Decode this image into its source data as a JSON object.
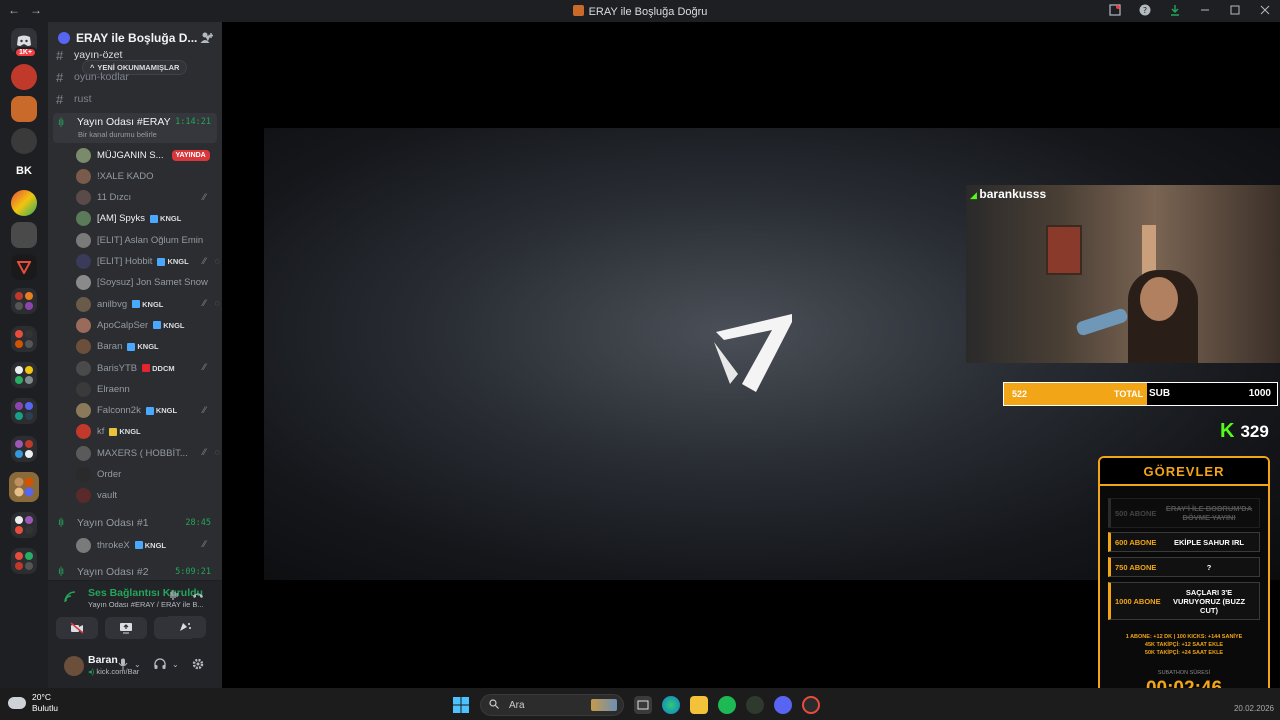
{
  "window": {
    "title": "ERAY ile Boşluğa Doğru",
    "nav_back": "←",
    "nav_forward": "→"
  },
  "servers": {
    "home_badge": "1K+",
    "items": [
      {
        "label": "",
        "color": "#2b2d31"
      },
      {
        "label": "",
        "color": "#c0392b"
      },
      {
        "label": "",
        "color": "#c96a2b"
      },
      {
        "label": "",
        "color": "#3a3a3a"
      },
      {
        "label": "BK",
        "color": "#1e1f22"
      },
      {
        "label": "",
        "color": "#e67e22"
      },
      {
        "label": "",
        "color": "#4a4a4a"
      },
      {
        "label": "",
        "color": "#222"
      },
      {
        "label": "",
        "color": "#333"
      },
      {
        "label": "",
        "color": "#333"
      },
      {
        "label": "",
        "color": "#333"
      },
      {
        "label": "",
        "color": "#333"
      },
      {
        "label": "",
        "color": "#333"
      },
      {
        "label": "",
        "color": "#8a6a3a"
      },
      {
        "label": "",
        "color": "#333"
      },
      {
        "label": "",
        "color": "#333"
      }
    ]
  },
  "guild": {
    "name": "ERAY ile Boşluğa D...",
    "unread_pill": "YENİ OKUNMAMIŞLAR"
  },
  "text_channels": [
    {
      "name": "yayın-özet"
    },
    {
      "name": "oyun-kodlar"
    },
    {
      "name": "rust"
    }
  ],
  "voice_channels": [
    {
      "name": "Yayın Odası #ERAY",
      "timer": "1:14:21",
      "status": "Bir kanal durumu belirle",
      "members": [
        {
          "name": "MÜJGANIN S...",
          "live": "YAYINDA",
          "tag": "",
          "mute": false,
          "deaf": false,
          "bright": true,
          "avatar": "#7a8a6a"
        },
        {
          "name": "!XALE KADO",
          "live": "",
          "tag": "",
          "mute": false,
          "deaf": false,
          "bright": false,
          "avatar": "#7a5a4a"
        },
        {
          "name": "11 Dızcı",
          "live": "",
          "tag": "",
          "mute": true,
          "deaf": false,
          "bright": false,
          "avatar": "#5a4a4a"
        },
        {
          "name": "[AM] Spyks",
          "live": "",
          "tag": "KNGL",
          "tagColor": "b",
          "mute": false,
          "deaf": false,
          "bright": true,
          "avatar": "#5a7a5a"
        },
        {
          "name": "[ELIT] Aslan Oğlum Emin",
          "live": "",
          "tag": "",
          "mute": false,
          "deaf": false,
          "bright": false,
          "avatar": "#7a7a7a"
        },
        {
          "name": "[ELIT] Hobbit",
          "live": "",
          "tag": "KNGL",
          "tagColor": "b",
          "mute": true,
          "deaf": true,
          "bright": false,
          "avatar": "#3a3a5a"
        },
        {
          "name": "[Soysuz] Jon Samet Snow",
          "live": "",
          "tag": "",
          "mute": false,
          "deaf": false,
          "bright": false,
          "avatar": "#8a8a8a"
        },
        {
          "name": "anilbvg",
          "live": "",
          "tag": "KNGL",
          "tagColor": "b",
          "mute": true,
          "deaf": true,
          "bright": false,
          "avatar": "#6a5a4a"
        },
        {
          "name": "ApoCalpSer",
          "live": "",
          "tag": "KNGL",
          "tagColor": "b",
          "mute": false,
          "deaf": false,
          "bright": false,
          "avatar": "#9a6a5a"
        },
        {
          "name": "Baran",
          "live": "",
          "tag": "KNGL",
          "tagColor": "b",
          "mute": false,
          "deaf": false,
          "bright": false,
          "avatar": "#6b4f3a"
        },
        {
          "name": "BarisYTB",
          "live": "",
          "tag": "DDCM",
          "tagColor": "r",
          "mute": true,
          "deaf": false,
          "bright": false,
          "avatar": "#4a4a4a"
        },
        {
          "name": "Elraenn",
          "live": "",
          "tag": "",
          "mute": false,
          "deaf": false,
          "bright": false,
          "avatar": "#3a3a3a"
        },
        {
          "name": "Falconn2k",
          "live": "",
          "tag": "KNGL",
          "tagColor": "b",
          "mute": true,
          "deaf": false,
          "bright": false,
          "avatar": "#8a7a5a"
        },
        {
          "name": "kf",
          "live": "",
          "tag": "KNGL",
          "tagColor": "y",
          "mute": false,
          "deaf": false,
          "bright": false,
          "avatar": "#c0392b"
        },
        {
          "name": "MAXERS ( HOBBİT...",
          "live": "",
          "tag": "",
          "mute": true,
          "deaf": true,
          "bright": false,
          "avatar": "#5a5a5a"
        },
        {
          "name": "Order",
          "live": "",
          "tag": "",
          "mute": false,
          "deaf": false,
          "bright": false,
          "avatar": "#2a2a2a"
        },
        {
          "name": "vault",
          "live": "",
          "tag": "",
          "mute": false,
          "deaf": false,
          "bright": false,
          "avatar": "#5a2a2a"
        }
      ]
    },
    {
      "name": "Yayın Odası #1",
      "timer": "28:45",
      "members": [
        {
          "name": "throkeX",
          "live": "",
          "tag": "KNGL",
          "tagColor": "b",
          "mute": true,
          "deaf": false,
          "bright": false,
          "avatar": "#7a7a7a"
        }
      ]
    },
    {
      "name": "Yayın Odası #2",
      "timer": "5:09:21",
      "members": []
    }
  ],
  "voice_panel": {
    "status": "Ses Bağlantısı Kuruldu",
    "sub": "Yayın Odası #ERAY / ERAY ile B..."
  },
  "user_panel": {
    "name": "Baran",
    "status": "kick.com/Bar"
  },
  "stream": {
    "cam_title": "barankusss",
    "sub_current": "522",
    "sub_label_a": "TOTAL",
    "sub_label_b": "SUB",
    "sub_goal": "1000",
    "sub_progress": 0.522,
    "kick_count": "329"
  },
  "tasks": {
    "title": "GÖREVLER",
    "rows": [
      {
        "need": "500 ABONE",
        "task": "ERAY'İ İLE BODRUM'DA DÖVME YAYINI",
        "done": true
      },
      {
        "need": "600 ABONE",
        "task": "EKİPLE SAHUR IRL",
        "done": false
      },
      {
        "need": "750 ABONE",
        "task": "?",
        "done": false
      },
      {
        "need": "1000 ABONE",
        "task": "SAÇLARI 3'E VURUYORUZ (BUZZ CUT)",
        "done": false
      }
    ],
    "info_1": "1 ABONE: +12 DK | 100 KICKS: +144 SANİYE",
    "info_2": "45K TAKİPÇİ: +12 SAAT EKLE",
    "info_3": "50K TAKİPÇİ: +24 SAAT EKLE",
    "timer_label": "SUBATHON SÜRESİ",
    "timer": "00:02:46"
  },
  "taskbar": {
    "temp": "20°C",
    "weather": "Bulutlu",
    "search": "Ara",
    "date": "20.02.2026"
  }
}
